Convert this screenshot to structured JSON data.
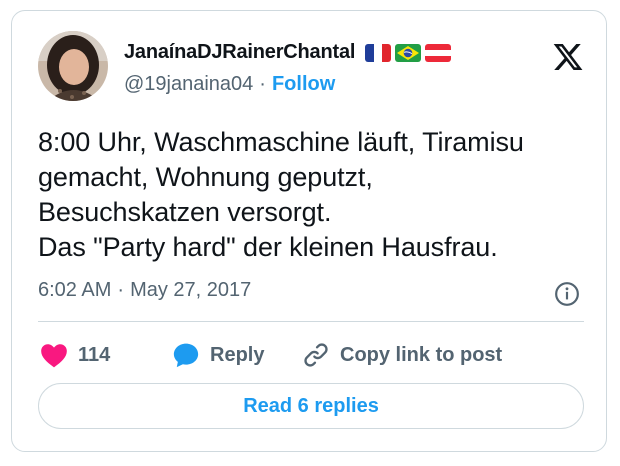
{
  "author": {
    "display_name": "JanaínaDJRainerChantal",
    "handle": "@19janaina04",
    "separator": "·",
    "follow_label": "Follow",
    "flags": [
      "france-flag",
      "brazil-flag",
      "austria-flag"
    ]
  },
  "tweet": {
    "text": "8:00 Uhr, Waschmaschine läuft, Tiramisu\ngemacht, Wohnung geputzt,\nBesuchskatzen versorgt.\nDas \"Party hard\" der kleinen Hausfrau.",
    "time": "6:02 AM",
    "separator": "·",
    "date": "May 27, 2017"
  },
  "actions": {
    "like_count": "114",
    "reply_label": "Reply",
    "copy_link_label": "Copy link to post"
  },
  "read_replies_label": "Read 6 replies",
  "colors": {
    "accent": "#1d9bf0",
    "like": "#f91880",
    "reply_icon": "#1d9bf0",
    "secondary_text": "#536471",
    "border": "#cfd9de"
  },
  "icons": {
    "logo": "x-logo-icon",
    "info": "info-icon",
    "like": "heart-icon",
    "reply": "speech-bubble-icon",
    "copy_link": "link-icon"
  }
}
